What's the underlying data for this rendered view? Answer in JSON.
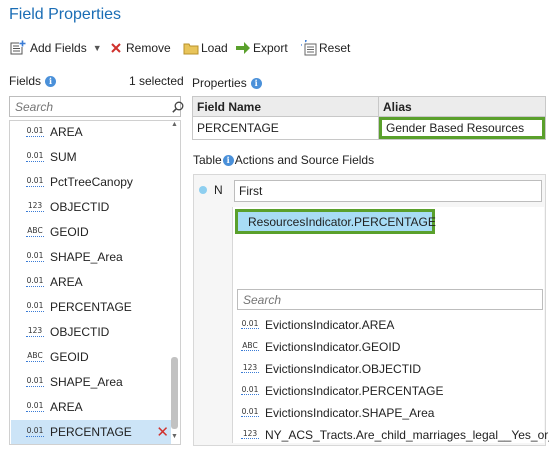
{
  "window": {
    "title": "Field Properties"
  },
  "toolbar": {
    "add_fields": "Add Fields",
    "remove": "Remove",
    "load": "Load",
    "export": "Export",
    "reset": "Reset"
  },
  "fields_panel": {
    "label": "Fields",
    "selected_count": "1 selected",
    "search_placeholder": "Search",
    "items": [
      {
        "type": "0.01",
        "name": "AREA"
      },
      {
        "type": "0.01",
        "name": "SUM"
      },
      {
        "type": "0.01",
        "name": "PctTreeCanopy"
      },
      {
        "type": "123",
        "name": "OBJECTID"
      },
      {
        "type": "ABC",
        "name": "GEOID"
      },
      {
        "type": "0.01",
        "name": "SHAPE_Area"
      },
      {
        "type": "0.01",
        "name": "AREA"
      },
      {
        "type": "0.01",
        "name": "PERCENTAGE"
      },
      {
        "type": "123",
        "name": "OBJECTID"
      },
      {
        "type": "ABC",
        "name": "GEOID"
      },
      {
        "type": "0.01",
        "name": "SHAPE_Area"
      },
      {
        "type": "0.01",
        "name": "AREA"
      },
      {
        "type": "0.01",
        "name": "PERCENTAGE"
      }
    ]
  },
  "properties": {
    "label": "Properties",
    "col_field_name": "Field Name",
    "col_alias": "Alias",
    "field_name": "PERCENTAGE",
    "alias": "Gender Based Resources"
  },
  "actions": {
    "label": "Table",
    "label_rest": "Actions and Source Fields",
    "merge_rule_letter": "N",
    "merge_rule_value": "First",
    "chosen_source": "ResourcesIndicator.PERCENTAGE",
    "search_placeholder": "Search",
    "source_fields": [
      {
        "type": "0.01",
        "name": "EvictionsIndicator.AREA"
      },
      {
        "type": "ABC",
        "name": "EvictionsIndicator.GEOID"
      },
      {
        "type": "123",
        "name": "EvictionsIndicator.OBJECTID"
      },
      {
        "type": "0.01",
        "name": "EvictionsIndicator.PERCENTAGE"
      },
      {
        "type": "0.01",
        "name": "EvictionsIndicator.SHAPE_Area"
      },
      {
        "type": "123",
        "name": "NY_ACS_Tracts.Are_child_marriages_legal__Yes_or_No"
      }
    ]
  },
  "colors": {
    "accent": "#1a6db5",
    "highlight_border": "#5aa02c",
    "selection": "#cce4f7",
    "remove": "#d0312d"
  },
  "icons": [
    "add-fields-icon",
    "remove-icon",
    "folder-icon",
    "export-arrow-icon",
    "reset-icon",
    "info-icon",
    "search-icon",
    "delete-x-icon"
  ]
}
